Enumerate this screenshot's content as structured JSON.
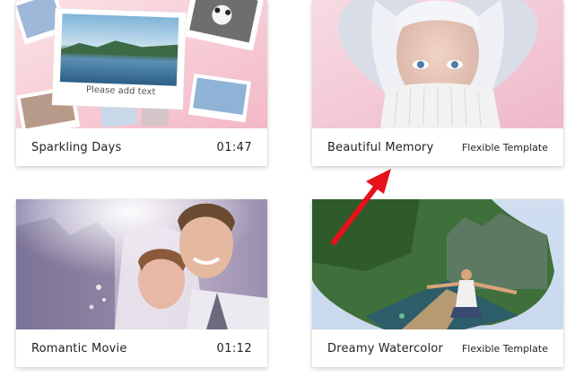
{
  "cards": [
    {
      "title": "Sparkling Days",
      "meta": "01:47",
      "placeholder_text": "Please add text"
    },
    {
      "title": "Beautiful Memory",
      "meta": "Flexible Template"
    },
    {
      "title": "Romantic Movie",
      "meta": "01:12"
    },
    {
      "title": "Dreamy Watercolor",
      "meta": "Flexible Template"
    }
  ],
  "colors": {
    "annotation_arrow": "#e5121b",
    "card_bg": "#ffffff",
    "text": "#222222"
  }
}
